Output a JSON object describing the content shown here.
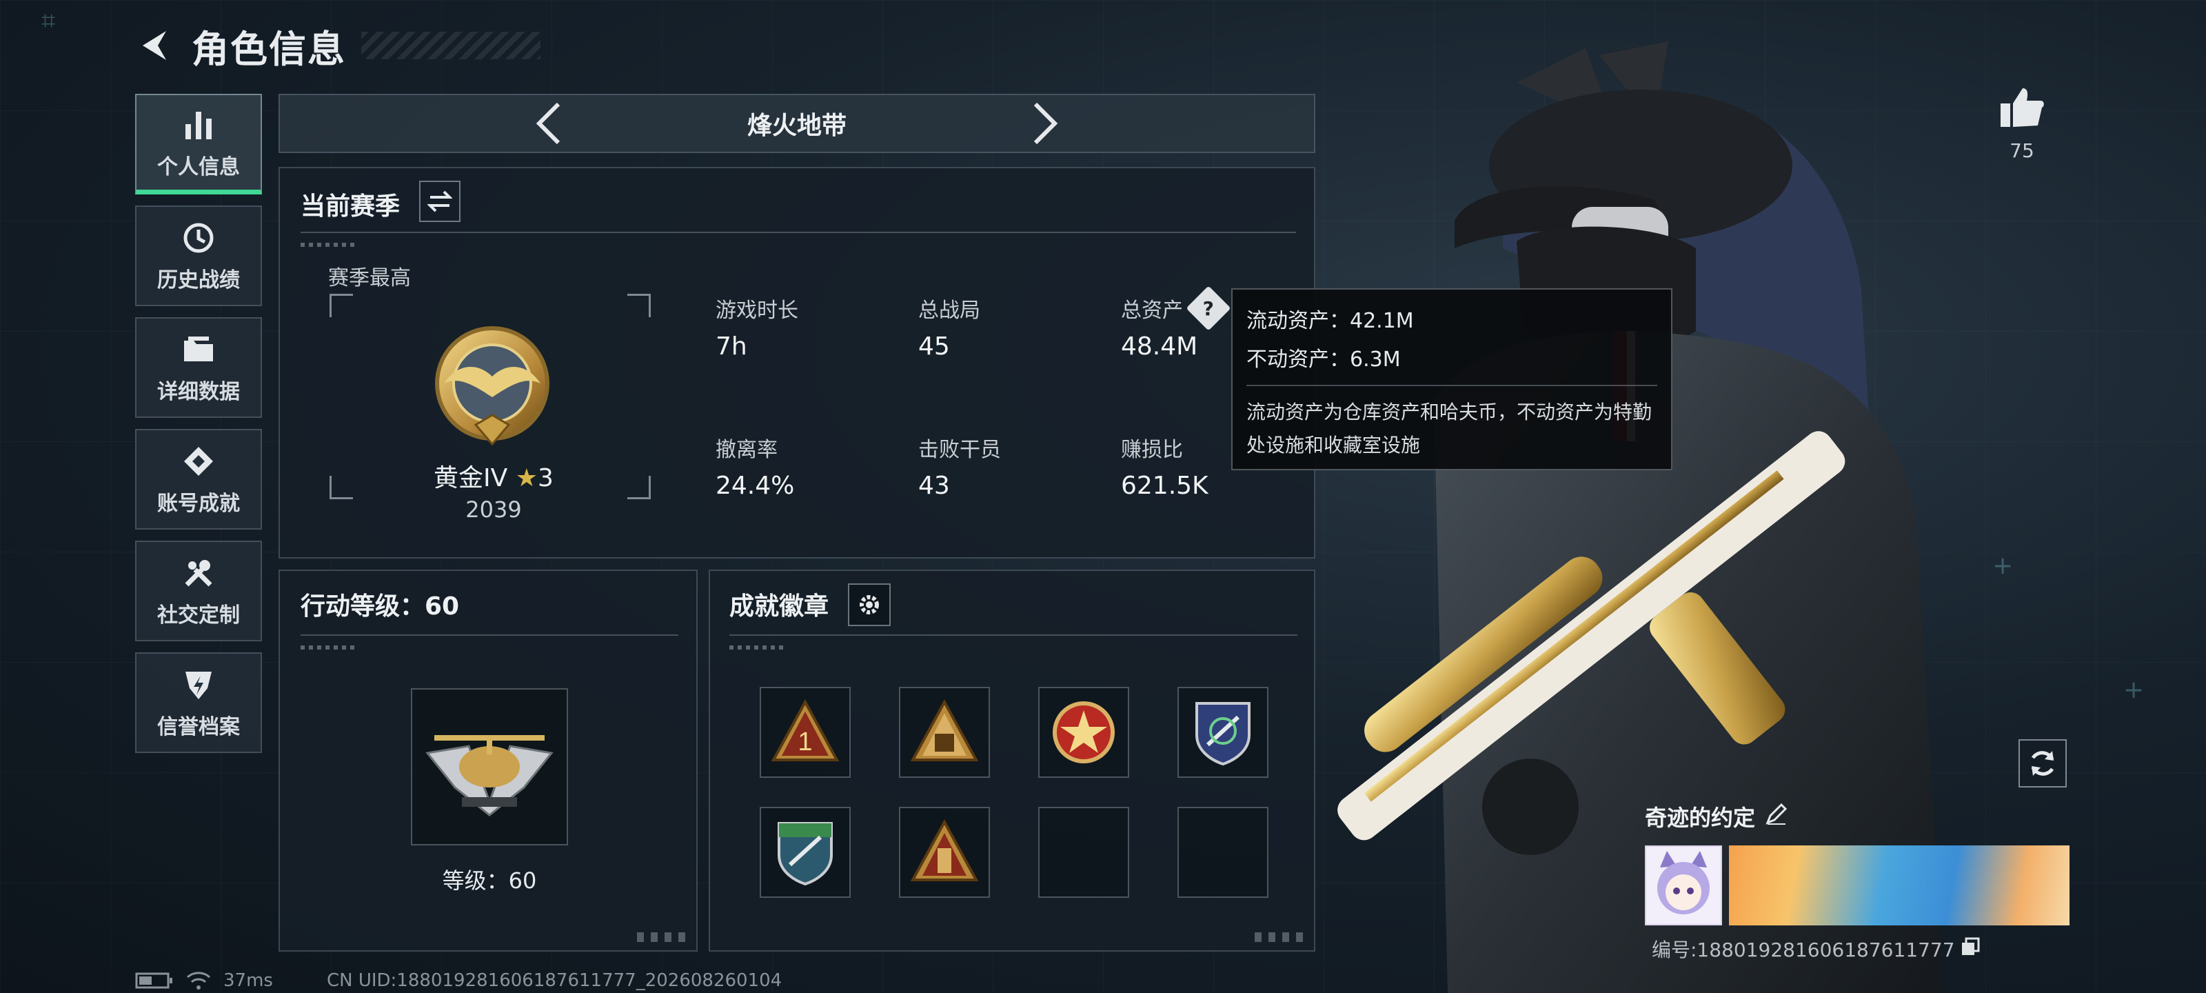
{
  "header": {
    "title": "角色信息"
  },
  "sidebar": {
    "items": [
      {
        "label": "个人信息",
        "icon": "bar-chart-icon",
        "active": true
      },
      {
        "label": "历史战绩",
        "icon": "history-clock-icon",
        "active": false
      },
      {
        "label": "详细数据",
        "icon": "folder-icon",
        "active": false
      },
      {
        "label": "账号成就",
        "icon": "achievement-icon",
        "active": false
      },
      {
        "label": "社交定制",
        "icon": "wrench-icon",
        "active": false
      },
      {
        "label": "信誉档案",
        "icon": "credit-shield-icon",
        "active": false
      }
    ]
  },
  "mode": {
    "title": "烽火地带"
  },
  "season": {
    "title": "当前赛季",
    "best_label": "赛季最高",
    "rank_name": "黄金IV",
    "rank_stars": "3",
    "rank_score": "2039",
    "stats": [
      {
        "label": "游戏时长",
        "value": "7h"
      },
      {
        "label": "总战局",
        "value": "45"
      },
      {
        "label": "总资产",
        "value": "48.4M"
      },
      {
        "label": "撤离率",
        "value": "24.4%"
      },
      {
        "label": "击败干员",
        "value": "43"
      },
      {
        "label": "赚损比",
        "value": "621.5K"
      }
    ]
  },
  "tooltip": {
    "liquid": "流动资产：42.1M",
    "fixed": "不动资产：6.3M",
    "desc": "流动资产为仓库资产和哈夫币，不动资产为特勤处设施和收藏室设施"
  },
  "level": {
    "title": "行动等级：60",
    "text": "等级：60"
  },
  "badges": {
    "title": "成就徽章",
    "slots": [
      {
        "icon": "triangle-1-badge-icon",
        "filled": true
      },
      {
        "icon": "triangle-soldiers-badge-icon",
        "filled": true
      },
      {
        "icon": "star-medal-badge-icon",
        "filled": true
      },
      {
        "icon": "blue-shield-badge-icon",
        "filled": true
      },
      {
        "icon": "green-shield-badge-icon",
        "filled": true
      },
      {
        "icon": "triangle-tower-badge-icon",
        "filled": true
      },
      {
        "icon": "empty-slot-icon",
        "filled": false
      },
      {
        "icon": "empty-slot-icon",
        "filled": false
      }
    ]
  },
  "likes": {
    "count": "75"
  },
  "card": {
    "name": "奇迹的约定",
    "id_text": "编号:1880192816061876117​77"
  },
  "status": {
    "ping": "37ms",
    "uid": "CN UID:18801928160618761177​7_202608260104"
  },
  "colors": {
    "accent_green": "#3fd895",
    "gold": "#c9a24a"
  }
}
